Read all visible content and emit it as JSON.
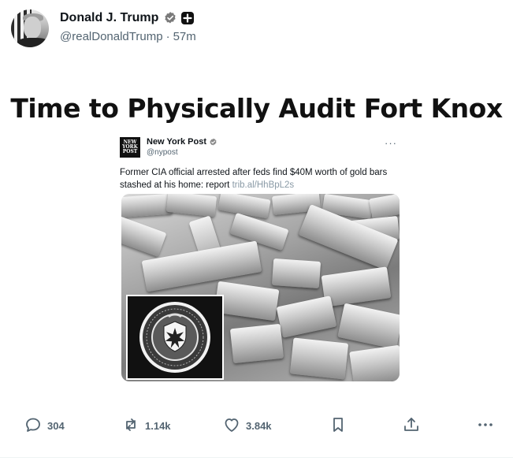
{
  "author": {
    "display_name": "Donald J. Trump",
    "handle": "@realDonaldTrump",
    "separator": "·",
    "time_ago": "57m",
    "verified_icon": "verified-badge-icon",
    "plus_icon": "plus-square-icon"
  },
  "post": {
    "headline": "Time to Physically Audit Fort Knox"
  },
  "embed": {
    "logo_lines": [
      "NEW",
      "YORK",
      "POST"
    ],
    "name": "New York Post",
    "handle": "@nypost",
    "more_label": "···",
    "text": "Former CIA official arrested after feds find $40M worth of gold bars stashed at his home: report ",
    "link": "trib.al/HhBpL2s",
    "image_icon": "gold-bars-with-cia-seal"
  },
  "actions": {
    "replies": "304",
    "reposts": "1.14k",
    "likes": "3.84k",
    "bookmark_icon": "bookmark-icon",
    "share_icon": "share-icon",
    "more_icon": "more-icon"
  },
  "colors": {
    "text_primary": "#0f1419",
    "text_secondary": "#536471"
  }
}
